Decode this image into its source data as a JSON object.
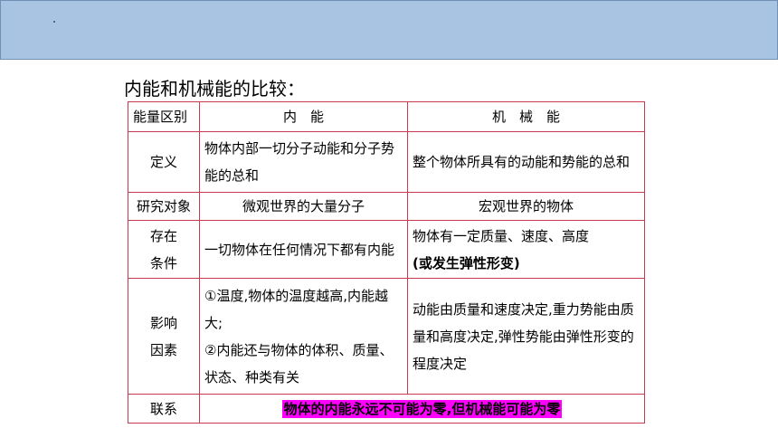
{
  "heading": "内能和机械能的比较：",
  "table": {
    "header": {
      "col1": "能量区别",
      "col2": "内　能",
      "col3": "机　械　能"
    },
    "rows": {
      "definition": {
        "label": "定义",
        "internal": "物体内部一切分子动能和分子势能的总和",
        "mechanical": "整个物体所具有的动能和势能的总和"
      },
      "object": {
        "label": "研究对象",
        "internal": "微观世界的大量分子",
        "mechanical": "宏观世界的物体"
      },
      "condition": {
        "label_line1": "存在",
        "label_line2": "条件",
        "internal": "一切物体在任何情况下都有内能",
        "mechanical_line1": "物体有一定质量、速度、高度",
        "mechanical_line2": "(或发生弹性形变)"
      },
      "factors": {
        "label_line1": "影响",
        "label_line2": "因素",
        "internal_line1": "①温度,物体的温度越高,内能越大;",
        "internal_line2": "②内能还与物体的体积、质量、状态、种类有关",
        "mechanical": "动能由质量和速度决定,重力势能由质量和高度决定,弹性势能由弹性形变的程度决定"
      },
      "relation": {
        "label": "联系",
        "text": "物体的内能永远不可能为零,但机械能可能为零"
      }
    }
  }
}
